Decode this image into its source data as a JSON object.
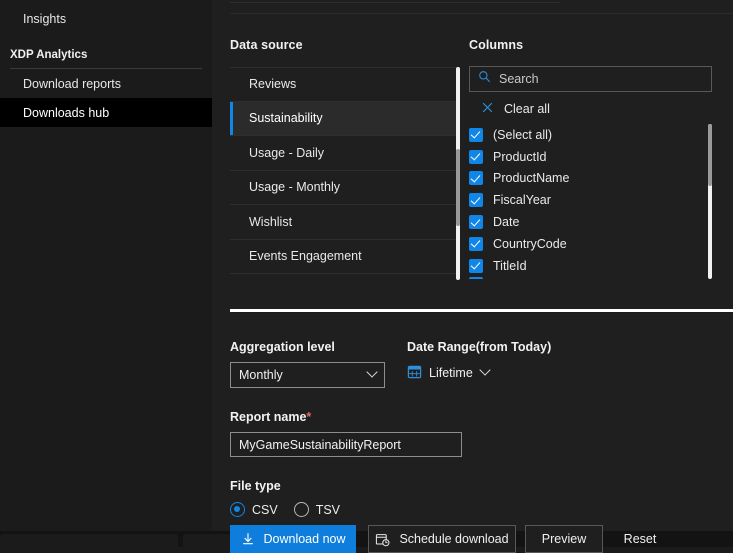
{
  "sidebar": {
    "items": [
      {
        "label": "Insights",
        "type": "item",
        "selected": false
      },
      {
        "label": "XDP Analytics",
        "type": "section"
      },
      {
        "label": "Download reports",
        "type": "item",
        "selected": false
      },
      {
        "label": "Downloads hub",
        "type": "item",
        "selected": true
      }
    ]
  },
  "main": {
    "data_source": {
      "title": "Data source",
      "items": [
        {
          "label": "Reviews",
          "selected": false
        },
        {
          "label": "Sustainability",
          "selected": true
        },
        {
          "label": "Usage - Daily",
          "selected": false
        },
        {
          "label": "Usage - Monthly",
          "selected": false
        },
        {
          "label": "Wishlist",
          "selected": false
        },
        {
          "label": "Events Engagement",
          "selected": false
        }
      ]
    },
    "columns": {
      "title": "Columns",
      "search_placeholder": "Search",
      "search_value": "",
      "search_icon": "search-icon",
      "clear_all_label": "Clear all",
      "clear_all_icon": "close-x-icon",
      "items": [
        {
          "label": "(Select all)",
          "checked": true
        },
        {
          "label": "ProductId",
          "checked": true
        },
        {
          "label": "ProductName",
          "checked": true
        },
        {
          "label": "FiscalYear",
          "checked": true
        },
        {
          "label": "Date",
          "checked": true
        },
        {
          "label": "CountryCode",
          "checked": true
        },
        {
          "label": "TitleId",
          "checked": true
        }
      ]
    },
    "form": {
      "aggregation_label": "Aggregation level",
      "aggregation_value": "Monthly",
      "date_range_label": "Date Range(from Today)",
      "date_range_value": "Lifetime",
      "date_range_icon": "calendar-icon",
      "report_name_label": "Report name",
      "report_name_required_mark": "*",
      "report_name_value": "MyGameSustainabilityReport",
      "file_type_label": "File type",
      "file_types": [
        {
          "label": "CSV",
          "selected": true
        },
        {
          "label": "TSV",
          "selected": false
        }
      ]
    },
    "actions": {
      "download_now": "Download now",
      "download_now_icon": "download-icon",
      "schedule_download": "Schedule download",
      "schedule_download_icon": "calendar-clock-icon",
      "preview": "Preview",
      "reset": "Reset"
    }
  },
  "colors": {
    "accent": "#0f86e8",
    "primary_button": "#0f7ddb",
    "panel_bg": "#1f1f1f",
    "nav_bg": "#1b1b1b",
    "selected_nav": "#000000",
    "required_mark": "#e06c5e"
  }
}
